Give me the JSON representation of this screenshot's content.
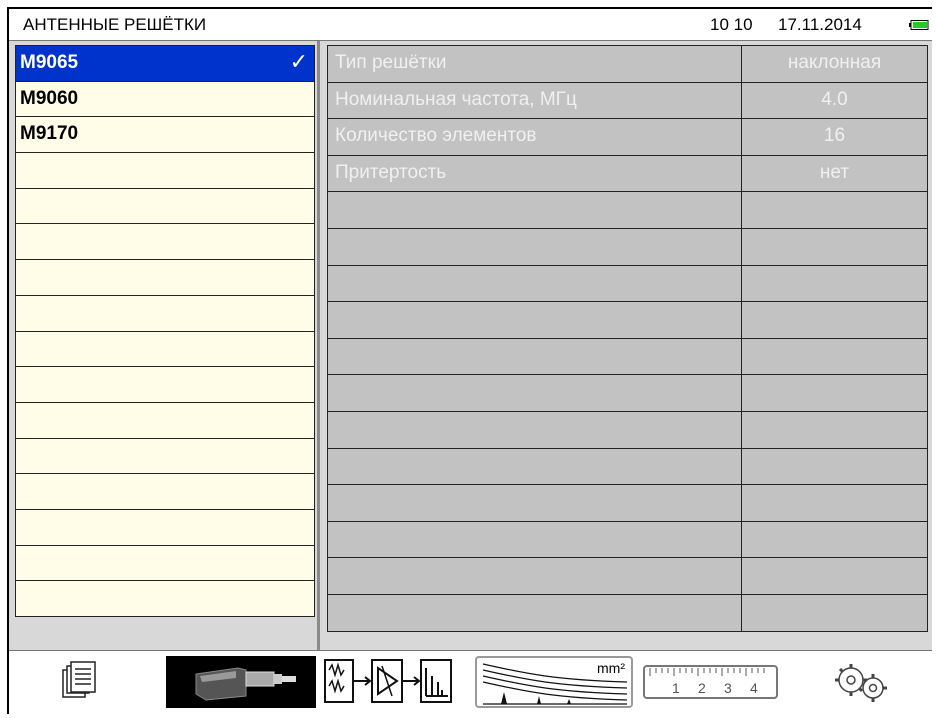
{
  "header": {
    "title": "АНТЕННЫЕ РЕШЁТКИ",
    "time": "10 10",
    "date": "17.11.2014",
    "battery_icon": "battery-icon",
    "battery_color": "#22cc22"
  },
  "array_list": {
    "items": [
      {
        "label": "M9065",
        "selected": true
      },
      {
        "label": "M9060",
        "selected": false
      },
      {
        "label": "M9170",
        "selected": false
      },
      {
        "label": ""
      },
      {
        "label": ""
      },
      {
        "label": ""
      },
      {
        "label": ""
      },
      {
        "label": ""
      },
      {
        "label": ""
      },
      {
        "label": ""
      },
      {
        "label": ""
      },
      {
        "label": ""
      },
      {
        "label": ""
      },
      {
        "label": ""
      },
      {
        "label": ""
      },
      {
        "label": ""
      }
    ],
    "check_mark": "✓",
    "selected_color": "#0033cc"
  },
  "properties": {
    "rows": [
      {
        "name": "Тип решётки",
        "value": "наклонная"
      },
      {
        "name": "Номинальная частота, МГц",
        "value": "4.0"
      },
      {
        "name": "Количество элементов",
        "value": "16"
      },
      {
        "name": "Притертость",
        "value": "нет"
      },
      {
        "name": "",
        "value": ""
      },
      {
        "name": "",
        "value": ""
      },
      {
        "name": "",
        "value": ""
      },
      {
        "name": "",
        "value": ""
      },
      {
        "name": "",
        "value": ""
      },
      {
        "name": "",
        "value": ""
      },
      {
        "name": "",
        "value": ""
      },
      {
        "name": "",
        "value": ""
      },
      {
        "name": "",
        "value": ""
      },
      {
        "name": "",
        "value": ""
      },
      {
        "name": "",
        "value": ""
      },
      {
        "name": "",
        "value": ""
      }
    ]
  },
  "toolbar": {
    "buttons": [
      {
        "icon": "documents-icon"
      },
      {
        "icon": "probe-icon"
      },
      {
        "icon": "signal-chain-icon"
      },
      {
        "icon": "tvg-curves-icon",
        "unit": "mm²"
      },
      {
        "icon": "ruler-icon",
        "ticks": [
          "1",
          "2",
          "3",
          "4"
        ]
      },
      {
        "icon": "settings-gears-icon"
      }
    ]
  }
}
